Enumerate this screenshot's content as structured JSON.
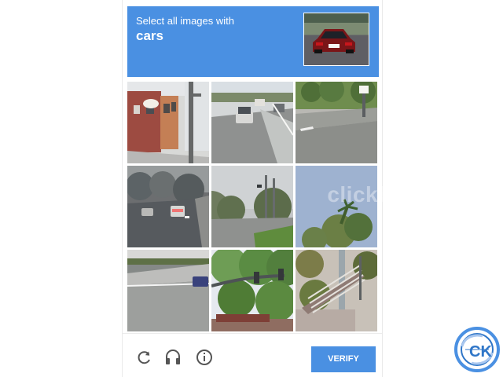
{
  "challenge": {
    "instruction": "Select all images with",
    "target": "cars"
  },
  "actions": {
    "verify_label": "VERIFY"
  },
  "watermark": "clickbd.com",
  "brand": {
    "logo_text": "CK"
  },
  "icons": {
    "reload": "reload-icon",
    "audio": "headphones-icon",
    "info": "info-icon"
  },
  "colors": {
    "accent": "#4a90e2",
    "text_on_accent": "#ffffff"
  }
}
